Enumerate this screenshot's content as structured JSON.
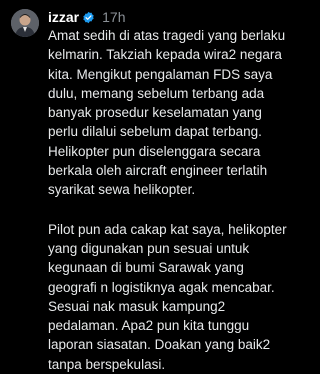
{
  "post": {
    "username": "izzar",
    "timestamp": "17h",
    "verified": true,
    "avatar_icon": "user-avatar",
    "verified_icon": "verified-badge-icon",
    "accent": "#1d9bf0",
    "paragraphs": [
      {
        "lines": [
          "Amat sedih di atas tragedi yang berlaku",
          "kelmarin. Takziah kepada wira2 negara",
          "kita. Mengikut pengalaman FDS saya",
          "dulu, memang sebelum terbang ada",
          "banyak prosedur keselamatan yang",
          "perlu dilalui sebelum dapat terbang.",
          "Helikopter pun diselenggara secara",
          "berkala oleh aircraft engineer terlatih",
          "syarikat sewa helikopter."
        ]
      },
      {
        "lines": [
          "Pilot pun ada cakap kat saya, helikopter",
          "yang digunakan pun sesuai untuk",
          "kegunaan di bumi Sarawak yang",
          "geografi n logistiknya agak mencabar.",
          "Sesuai nak masuk kampung2",
          "pedalaman. Apa2 pun kita tunggu",
          "laporan siasatan. Doakan yang baik2",
          "tanpa berspekulasi."
        ]
      }
    ]
  }
}
